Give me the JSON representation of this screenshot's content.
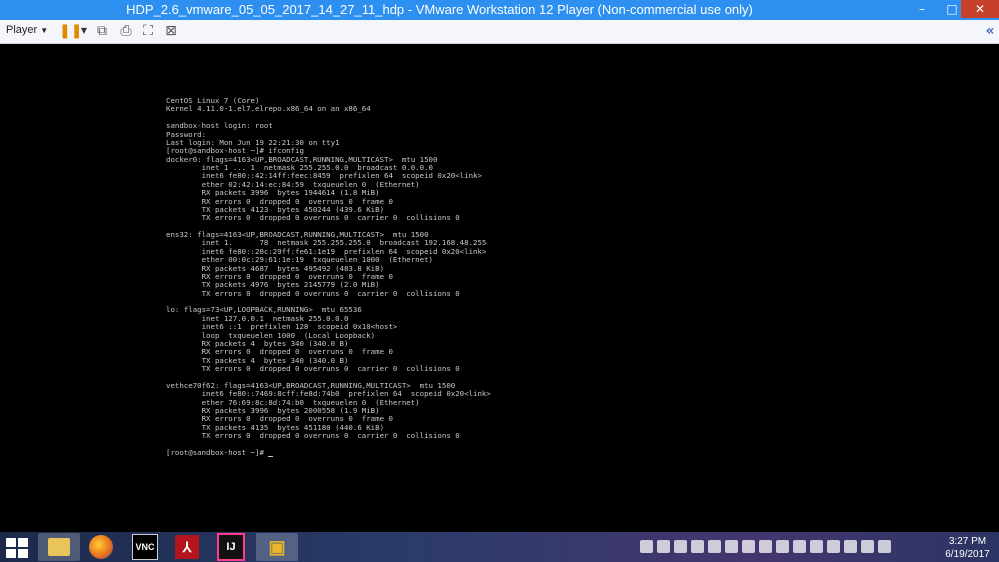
{
  "window": {
    "title": "HDP_2.6_vmware_05_05_2017_14_27_11_hdp - VMware Workstation 12 Player (Non-commercial use only)",
    "minimize_glyph": "–",
    "maximize_glyph": "□",
    "close_glyph": "✕"
  },
  "toolbar": {
    "player_menu_label": "Player",
    "icons": [
      "pause-icon",
      "send-ctrl-alt-del-icon",
      "removable-devices-icon",
      "fit-window-icon",
      "unity-icon",
      "collapse-toolbar-icon"
    ]
  },
  "console": {
    "lines": [
      "CentOS Linux 7 (Core)",
      "Kernel 4.11.0-1.el7.elrepo.x86_64 on an x86_64",
      "",
      "sandbox-host login: root",
      "Password:",
      "Last login: Mon Jun 19 22:21:30 on tty1",
      "[root@sandbox-host ~]# ifconfig",
      "docker0: flags=4163<UP,BROADCAST,RUNNING,MULTICAST>  mtu 1500",
      "        inet 1 ... 1  netmask 255.255.0.0  broadcast 0.0.0.0",
      "        inet6 fe80::42:14ff:feec:8459  prefixlen 64  scopeid 0x20<link>",
      "        ether 02:42:14:ec:84:59  txqueuelen 0  (Ethernet)",
      "        RX packets 3996  bytes 1944614 (1.8 MiB)",
      "        RX errors 0  dropped 0  overruns 0  frame 0",
      "        TX packets 4123  bytes 450244 (439.6 KiB)",
      "        TX errors 0  dropped 0 overruns 0  carrier 0  collisions 0",
      "",
      "ens32: flags=4163<UP,BROADCAST,RUNNING,MULTICAST>  mtu 1500",
      "        inet 1.      78  netmask 255.255.255.0  broadcast 192.168.48.255",
      "        inet6 fe80::20c:29ff:fe61:1e19  prefixlen 64  scopeid 0x20<link>",
      "        ether 00:0c:29:61:1e:19  txqueuelen 1000  (Ethernet)",
      "        RX packets 4687  bytes 495492 (483.8 KiB)",
      "        RX errors 0  dropped 0  overruns 0  frame 0",
      "        TX packets 4976  bytes 2145779 (2.0 MiB)",
      "        TX errors 0  dropped 0 overruns 0  carrier 0  collisions 0",
      "",
      "lo: flags=73<UP,LOOPBACK,RUNNING>  mtu 65536",
      "        inet 127.0.0.1  netmask 255.0.0.0",
      "        inet6 ::1  prefixlen 128  scopeid 0x10<host>",
      "        loop  txqueuelen 1000  (Local Loopback)",
      "        RX packets 4  bytes 340 (340.0 B)",
      "        RX errors 0  dropped 0  overruns 0  frame 0",
      "        TX packets 4  bytes 340 (340.0 B)",
      "        TX errors 0  dropped 0 overruns 0  carrier 0  collisions 0",
      "",
      "vethce70f62: flags=4163<UP,BROADCAST,RUNNING,MULTICAST>  mtu 1500",
      "        inet6 fe80::7469:8cff:fe8d:74b0  prefixlen 64  scopeid 0x20<link>",
      "        ether 76:69:8c:8d:74:b0  txqueuelen 0  (Ethernet)",
      "        RX packets 3996  bytes 2000558 (1.9 MiB)",
      "        RX errors 0  dropped 0  overruns 0  frame 0",
      "        TX packets 4135  bytes 451180 (440.6 KiB)",
      "        TX errors 0  dropped 0 overruns 0  carrier 0  collisions 0",
      ""
    ],
    "prompt": "[root@sandbox-host ~]# "
  },
  "taskbar": {
    "apps": [
      {
        "name": "file-explorer-icon",
        "glyph": "",
        "color": "#e8c45a",
        "active": true
      },
      {
        "name": "firefox-icon",
        "glyph": "",
        "color": "#e66a1f",
        "active": false
      },
      {
        "name": "vnc-viewer-icon",
        "glyph": "VNC",
        "color": "#ffffff",
        "active": false
      },
      {
        "name": "pdf-reader-icon",
        "glyph": "⅄",
        "color": "#b4141b",
        "active": false
      },
      {
        "name": "intellij-icon",
        "glyph": "IJ",
        "color": "#111111",
        "active": false
      },
      {
        "name": "vmware-player-icon",
        "glyph": "▣",
        "color": "#e8b72a",
        "active": true
      }
    ],
    "clock_time": "3:27 PM",
    "clock_date": "6/19/2017"
  }
}
